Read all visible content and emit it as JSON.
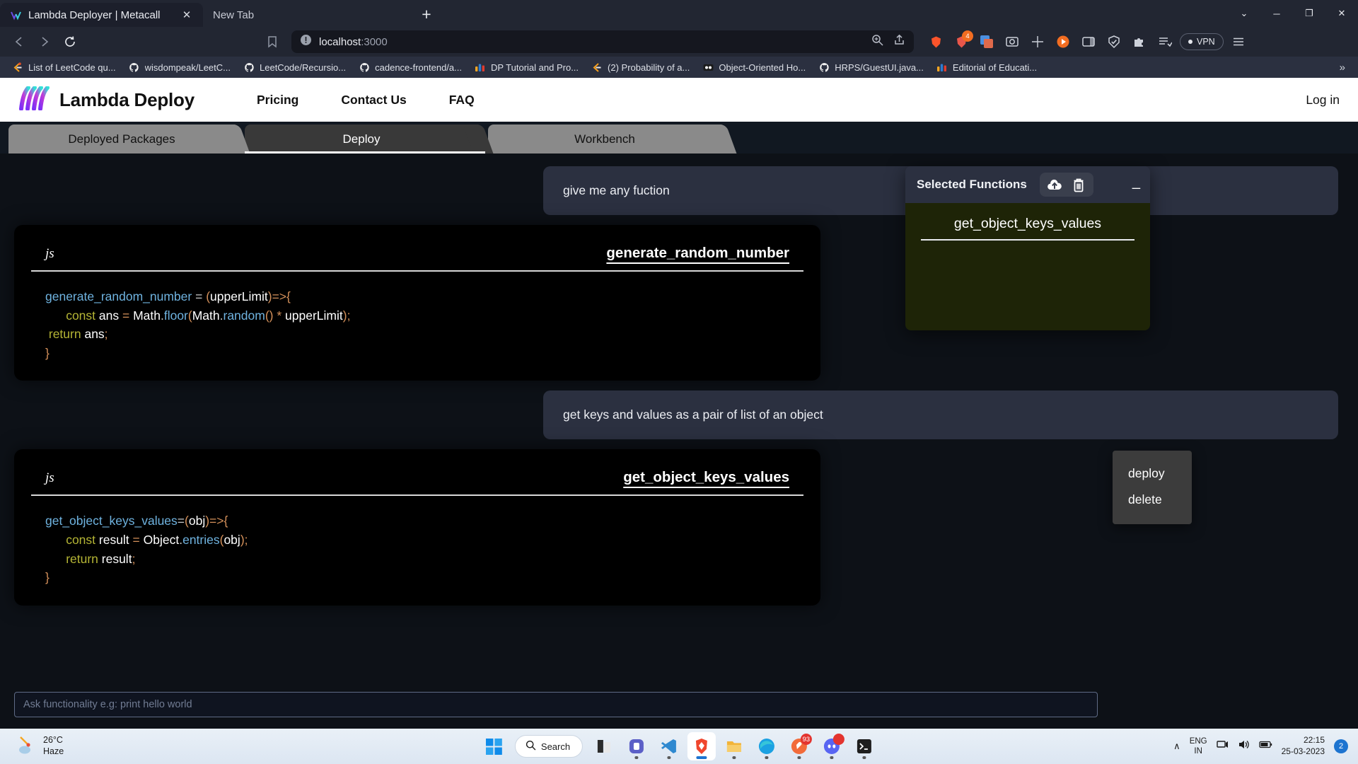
{
  "browser": {
    "tabs": [
      {
        "title": "Lambda Deployer | Metacall",
        "active": true
      },
      {
        "title": "New Tab",
        "active": false
      }
    ],
    "newtab_label": "+",
    "close_label": "✕",
    "window_controls": {
      "chevron": "⌄",
      "minimize": "─",
      "maximize": "❐",
      "close": "✕"
    },
    "address": {
      "url_host": "localhost",
      "url_port": ":3000",
      "security": "not-secure"
    },
    "vpn_label": "VPN",
    "bookmarks": [
      {
        "label": "List of LeetCode qu...",
        "icon": "leetcode-icon"
      },
      {
        "label": "wisdompeak/LeetC...",
        "icon": "github-icon"
      },
      {
        "label": "LeetCode/Recursio...",
        "icon": "github-icon"
      },
      {
        "label": "cadence-frontend/a...",
        "icon": "github-icon"
      },
      {
        "label": "DP Tutorial and Pro...",
        "icon": "codeforces-icon"
      },
      {
        "label": "(2) Probability of a...",
        "icon": "leetcode-icon"
      },
      {
        "label": "Object-Oriented Ho...",
        "icon": "video-icon"
      },
      {
        "label": "HRPS/GuestUI.java...",
        "icon": "github-icon"
      },
      {
        "label": "Editorial of Educati...",
        "icon": "codeforces-icon"
      }
    ],
    "bookmarks_overflow": "»"
  },
  "site": {
    "brand": "Lambda Deploy",
    "nav": [
      "Pricing",
      "Contact Us",
      "FAQ"
    ],
    "login": "Log in",
    "tabs": [
      {
        "label": "Deployed Packages",
        "active": false
      },
      {
        "label": "Deploy",
        "active": true
      },
      {
        "label": "Workbench",
        "active": false
      }
    ]
  },
  "chat": {
    "messages": [
      {
        "role": "user",
        "text": "give me any fuction"
      },
      {
        "role": "code",
        "lang": "js",
        "name": "generate_random_number",
        "lines": [
          [
            {
              "t": "generate_random_number",
              "c": "t-fn"
            },
            {
              "t": " = ",
              "c": "t-op"
            },
            {
              "t": "(",
              "c": "t-punc"
            },
            {
              "t": "upperLimit",
              "c": "t-var"
            },
            {
              "t": ")",
              "c": "t-punc"
            },
            {
              "t": "=>",
              "c": "t-punc"
            },
            {
              "t": "{",
              "c": "t-punc"
            }
          ],
          [
            {
              "t": "      ",
              "c": "t-op"
            },
            {
              "t": "const",
              "c": "t-kw"
            },
            {
              "t": " ans ",
              "c": "t-var"
            },
            {
              "t": "= ",
              "c": "t-punc"
            },
            {
              "t": "Math",
              "c": "t-var"
            },
            {
              "t": ".",
              "c": "t-op"
            },
            {
              "t": "floor",
              "c": "t-meth"
            },
            {
              "t": "(",
              "c": "t-punc"
            },
            {
              "t": "Math",
              "c": "t-var"
            },
            {
              "t": ".",
              "c": "t-op"
            },
            {
              "t": "random",
              "c": "t-meth"
            },
            {
              "t": "()",
              "c": "t-punc"
            },
            {
              "t": " * ",
              "c": "t-punc"
            },
            {
              "t": "upperLimit",
              "c": "t-var"
            },
            {
              "t": ")",
              "c": "t-punc"
            },
            {
              "t": ";",
              "c": "t-punc"
            }
          ],
          [
            {
              "t": " ",
              "c": "t-op"
            },
            {
              "t": "return",
              "c": "t-kw"
            },
            {
              "t": " ans",
              "c": "t-var"
            },
            {
              "t": ";",
              "c": "t-punc"
            }
          ],
          [
            {
              "t": "}",
              "c": "t-punc"
            }
          ]
        ]
      },
      {
        "role": "user",
        "text": "get keys and values as a pair of list of an object"
      },
      {
        "role": "code",
        "lang": "js",
        "name": "get_object_keys_values",
        "lines": [
          [
            {
              "t": "get_object_keys_values",
              "c": "t-fn"
            },
            {
              "t": "=",
              "c": "t-op"
            },
            {
              "t": "(",
              "c": "t-punc"
            },
            {
              "t": "obj",
              "c": "t-var"
            },
            {
              "t": ")",
              "c": "t-punc"
            },
            {
              "t": "=>",
              "c": "t-punc"
            },
            {
              "t": "{",
              "c": "t-punc"
            }
          ],
          [
            {
              "t": "      ",
              "c": "t-op"
            },
            {
              "t": "const",
              "c": "t-kw"
            },
            {
              "t": " result ",
              "c": "t-var"
            },
            {
              "t": "= ",
              "c": "t-punc"
            },
            {
              "t": "Object",
              "c": "t-var"
            },
            {
              "t": ".",
              "c": "t-op"
            },
            {
              "t": "entries",
              "c": "t-meth"
            },
            {
              "t": "(",
              "c": "t-punc"
            },
            {
              "t": "obj",
              "c": "t-var"
            },
            {
              "t": ")",
              "c": "t-punc"
            },
            {
              "t": ";",
              "c": "t-punc"
            }
          ],
          [
            {
              "t": "      ",
              "c": "t-op"
            },
            {
              "t": "return",
              "c": "t-kw"
            },
            {
              "t": " result",
              "c": "t-var"
            },
            {
              "t": ";",
              "c": "t-punc"
            }
          ],
          [
            {
              "t": "}",
              "c": "t-punc"
            }
          ]
        ]
      }
    ],
    "prompt_placeholder": "Ask functionality e.g: print hello world"
  },
  "selected_panel": {
    "title": "Selected Functions",
    "upload_icon": "cloud-upload-icon",
    "delete_icon": "trash-icon",
    "minimize_icon": "minimize-icon",
    "items": [
      "get_object_keys_values"
    ]
  },
  "context_menu": {
    "items": [
      "deploy",
      "delete"
    ]
  },
  "taskbar": {
    "weather": {
      "temp": "26°C",
      "condition": "Haze"
    },
    "search_label": "Search",
    "apps": [
      {
        "name": "start",
        "active": false
      },
      {
        "name": "file-explorer-dark",
        "active": false
      },
      {
        "name": "teams",
        "active": false
      },
      {
        "name": "vs-code",
        "active": false
      },
      {
        "name": "brave",
        "active": true
      },
      {
        "name": "file-explorer",
        "active": false
      },
      {
        "name": "edge",
        "active": false
      },
      {
        "name": "postman",
        "active": false,
        "badge": "93"
      },
      {
        "name": "discord",
        "active": false,
        "badge": " "
      },
      {
        "name": "terminal",
        "active": false
      }
    ],
    "language": {
      "line1": "ENG",
      "line2": "IN"
    },
    "clock": {
      "time": "22:15",
      "date": "25-03-2023"
    },
    "notification_count": "2",
    "chevron": "∧"
  }
}
